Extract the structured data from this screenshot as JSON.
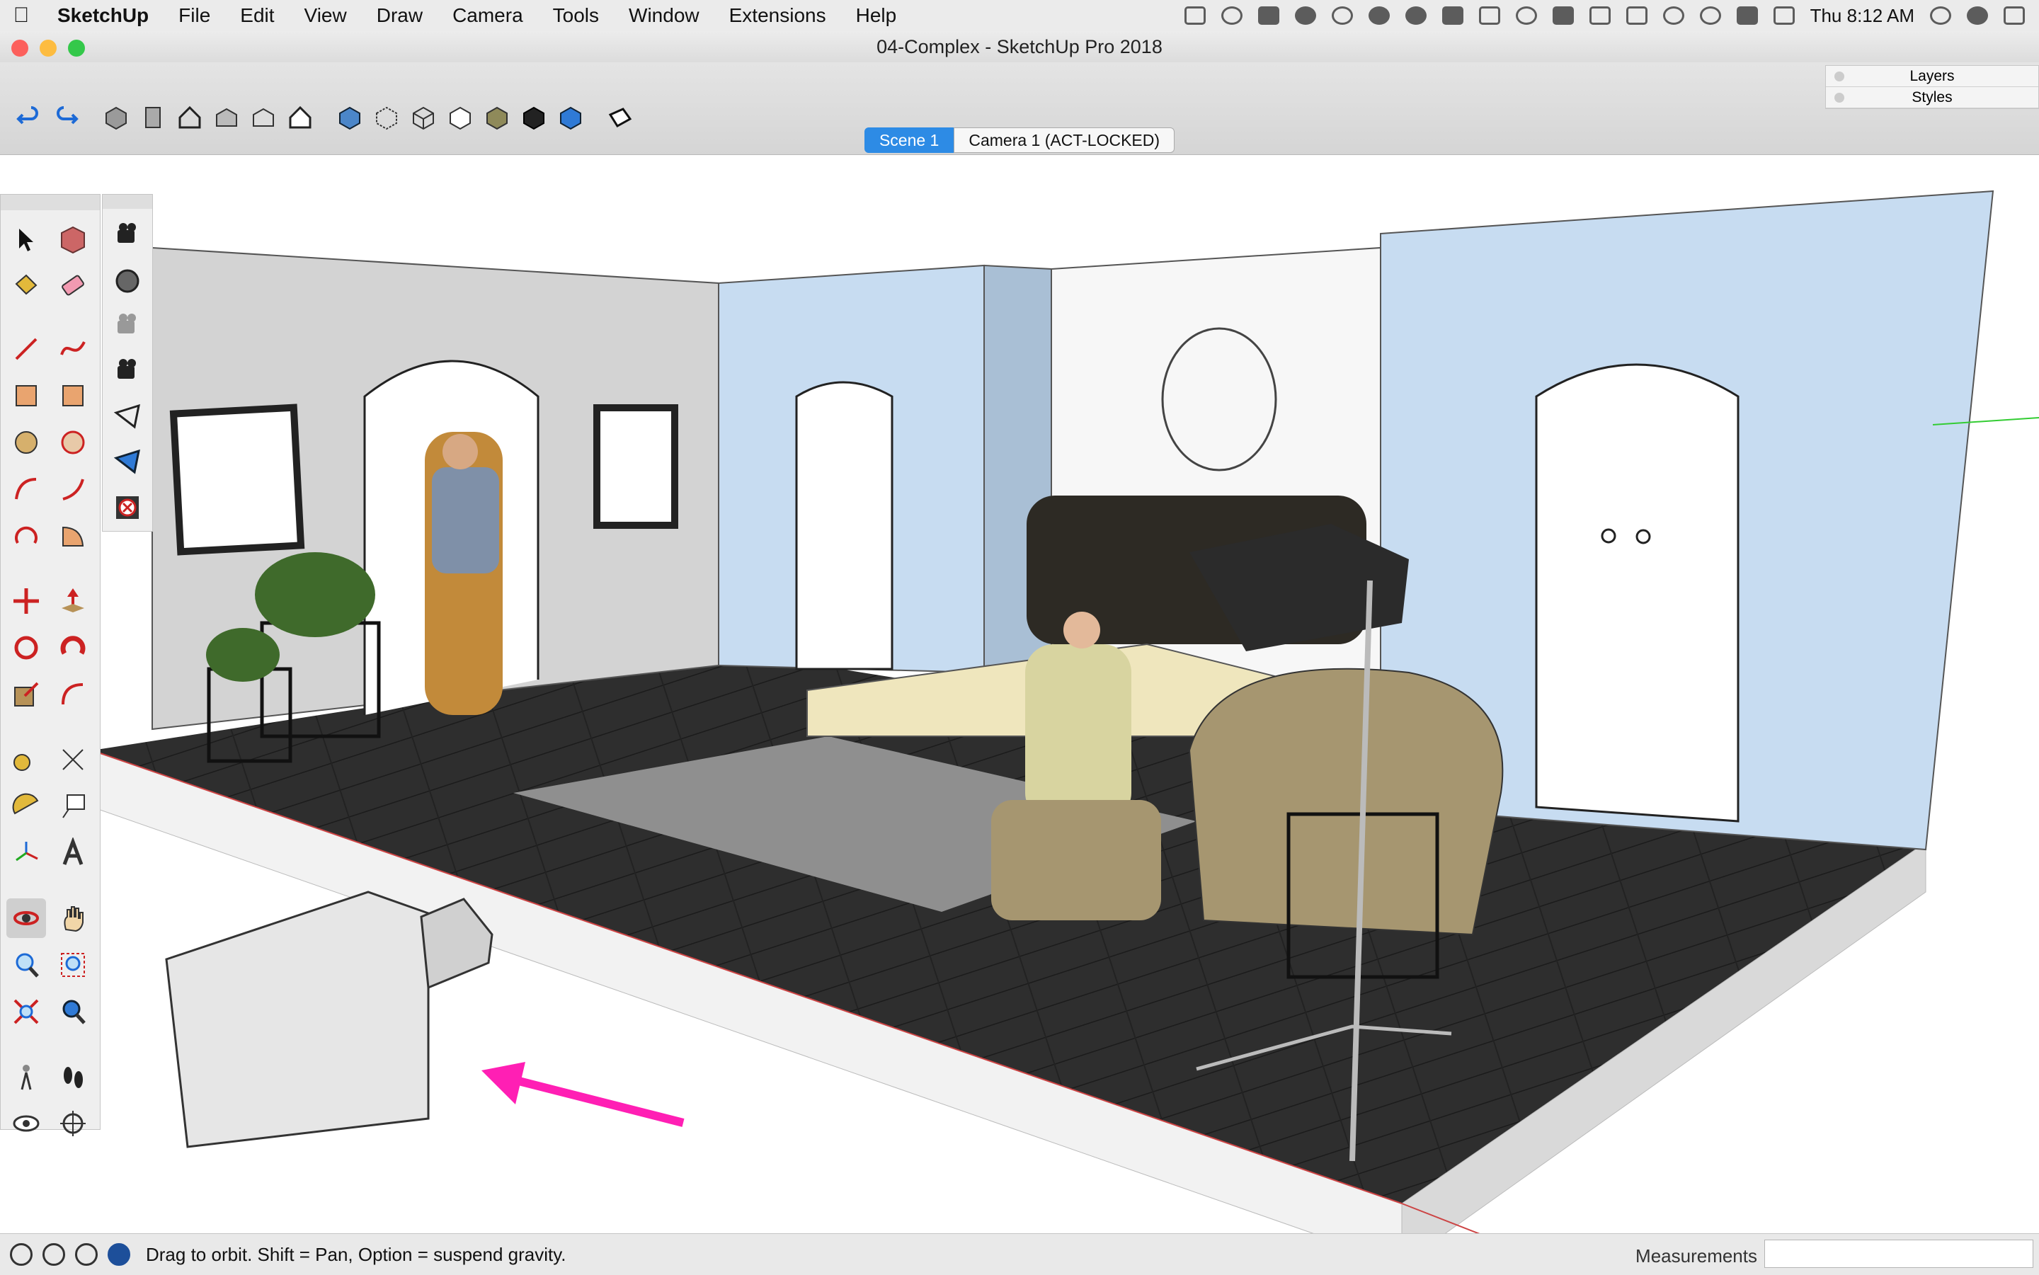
{
  "menubar": {
    "app_name": "SketchUp",
    "items": [
      "File",
      "Edit",
      "View",
      "Draw",
      "Camera",
      "Tools",
      "Window",
      "Extensions",
      "Help"
    ],
    "clock": "Thu 8:12 AM"
  },
  "window": {
    "title": "04-Complex - SketchUp Pro 2018"
  },
  "tray": {
    "rows": [
      "Layers",
      "Styles"
    ]
  },
  "scenes": {
    "tabs": [
      "Scene 1",
      "Camera 1 (ACT-LOCKED)"
    ],
    "active_index": 0
  },
  "status": {
    "message": "Drag to orbit. Shift = Pan, Option = suspend gravity.",
    "measurements_label": "Measurements",
    "measurements_value": ""
  },
  "colors": {
    "accent": "#2d8be5",
    "arrow": "#ff1fb4",
    "floor": "#2e2e2e",
    "wall_blue": "#c7dcf1",
    "wall_gray": "#d3d3d3"
  }
}
